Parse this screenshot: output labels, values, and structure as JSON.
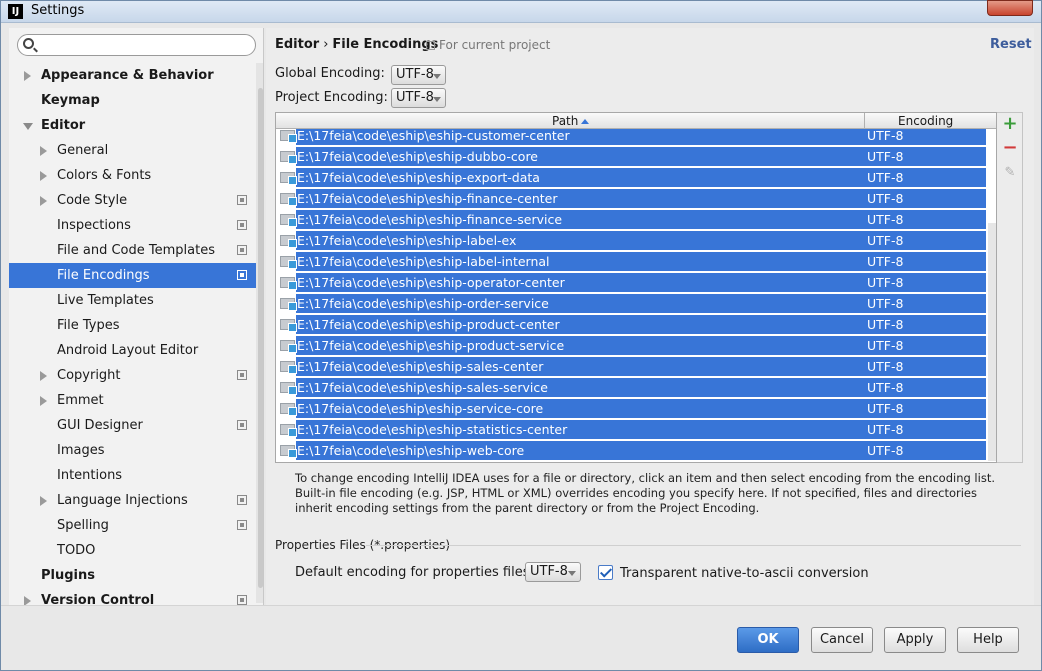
{
  "window": {
    "title": "Settings",
    "app_icon": "IJ"
  },
  "search": {
    "placeholder": "",
    "value": ""
  },
  "sidebar": {
    "items": [
      {
        "label": "Appearance & Behavior",
        "level": 0,
        "bold": true,
        "arrow": "right",
        "project": false,
        "selected": false
      },
      {
        "label": "Keymap",
        "level": 0,
        "bold": true,
        "arrow": "none",
        "project": false,
        "selected": false
      },
      {
        "label": "Editor",
        "level": 0,
        "bold": true,
        "arrow": "down",
        "project": false,
        "selected": false
      },
      {
        "label": "General",
        "level": 1,
        "bold": false,
        "arrow": "right",
        "project": false,
        "selected": false
      },
      {
        "label": "Colors & Fonts",
        "level": 1,
        "bold": false,
        "arrow": "right",
        "project": false,
        "selected": false
      },
      {
        "label": "Code Style",
        "level": 1,
        "bold": false,
        "arrow": "right",
        "project": true,
        "selected": false
      },
      {
        "label": "Inspections",
        "level": 1,
        "bold": false,
        "arrow": "none",
        "project": true,
        "selected": false
      },
      {
        "label": "File and Code Templates",
        "level": 1,
        "bold": false,
        "arrow": "none",
        "project": true,
        "selected": false
      },
      {
        "label": "File Encodings",
        "level": 1,
        "bold": false,
        "arrow": "none",
        "project": true,
        "selected": true
      },
      {
        "label": "Live Templates",
        "level": 1,
        "bold": false,
        "arrow": "none",
        "project": false,
        "selected": false
      },
      {
        "label": "File Types",
        "level": 1,
        "bold": false,
        "arrow": "none",
        "project": false,
        "selected": false
      },
      {
        "label": "Android Layout Editor",
        "level": 1,
        "bold": false,
        "arrow": "none",
        "project": false,
        "selected": false
      },
      {
        "label": "Copyright",
        "level": 1,
        "bold": false,
        "arrow": "right",
        "project": true,
        "selected": false
      },
      {
        "label": "Emmet",
        "level": 1,
        "bold": false,
        "arrow": "right",
        "project": false,
        "selected": false
      },
      {
        "label": "GUI Designer",
        "level": 1,
        "bold": false,
        "arrow": "none",
        "project": true,
        "selected": false
      },
      {
        "label": "Images",
        "level": 1,
        "bold": false,
        "arrow": "none",
        "project": false,
        "selected": false
      },
      {
        "label": "Intentions",
        "level": 1,
        "bold": false,
        "arrow": "none",
        "project": false,
        "selected": false
      },
      {
        "label": "Language Injections",
        "level": 1,
        "bold": false,
        "arrow": "right",
        "project": true,
        "selected": false
      },
      {
        "label": "Spelling",
        "level": 1,
        "bold": false,
        "arrow": "none",
        "project": true,
        "selected": false
      },
      {
        "label": "TODO",
        "level": 1,
        "bold": false,
        "arrow": "none",
        "project": false,
        "selected": false
      },
      {
        "label": "Plugins",
        "level": 0,
        "bold": true,
        "arrow": "none",
        "project": false,
        "selected": false
      },
      {
        "label": "Version Control",
        "level": 0,
        "bold": true,
        "arrow": "right",
        "project": true,
        "selected": false
      }
    ]
  },
  "header": {
    "crumb_parent": "Editor",
    "crumb_sep": "›",
    "crumb_current": "File Encodings",
    "for_project": "For current project",
    "reset": "Reset"
  },
  "encodings": {
    "global_label": "Global Encoding:",
    "global_value": "UTF-8",
    "project_label": "Project Encoding:",
    "project_value": "UTF-8"
  },
  "table": {
    "col_path": "Path",
    "col_encoding": "Encoding",
    "rows": [
      {
        "path": "E:\\17feia\\code\\eship\\eship-customer-center",
        "encoding": "UTF-8"
      },
      {
        "path": "E:\\17feia\\code\\eship\\eship-dubbo-core",
        "encoding": "UTF-8"
      },
      {
        "path": "E:\\17feia\\code\\eship\\eship-export-data",
        "encoding": "UTF-8"
      },
      {
        "path": "E:\\17feia\\code\\eship\\eship-finance-center",
        "encoding": "UTF-8"
      },
      {
        "path": "E:\\17feia\\code\\eship\\eship-finance-service",
        "encoding": "UTF-8"
      },
      {
        "path": "E:\\17feia\\code\\eship\\eship-label-ex",
        "encoding": "UTF-8"
      },
      {
        "path": "E:\\17feia\\code\\eship\\eship-label-internal",
        "encoding": "UTF-8"
      },
      {
        "path": "E:\\17feia\\code\\eship\\eship-operator-center",
        "encoding": "UTF-8"
      },
      {
        "path": "E:\\17feia\\code\\eship\\eship-order-service",
        "encoding": "UTF-8"
      },
      {
        "path": "E:\\17feia\\code\\eship\\eship-product-center",
        "encoding": "UTF-8"
      },
      {
        "path": "E:\\17feia\\code\\eship\\eship-product-service",
        "encoding": "UTF-8"
      },
      {
        "path": "E:\\17feia\\code\\eship\\eship-sales-center",
        "encoding": "UTF-8"
      },
      {
        "path": "E:\\17feia\\code\\eship\\eship-sales-service",
        "encoding": "UTF-8"
      },
      {
        "path": "E:\\17feia\\code\\eship\\eship-service-core",
        "encoding": "UTF-8"
      },
      {
        "path": "E:\\17feia\\code\\eship\\eship-statistics-center",
        "encoding": "UTF-8"
      },
      {
        "path": "E:\\17feia\\code\\eship\\eship-web-core",
        "encoding": "UTF-8"
      }
    ]
  },
  "help_text": "To change encoding IntelliJ IDEA uses for a file or directory, click an item and then select encoding from the encoding list. Built-in file encoding (e.g. JSP, HTML or XML) overrides encoding you specify here. If not specified, files and directories inherit encoding settings from the parent directory or from the Project Encoding.",
  "properties": {
    "title": "Properties Files (*.properties)",
    "default_label": "Default encoding for properties files:",
    "default_value": "UTF-8",
    "native_to_ascii_label": "Transparent native-to-ascii conversion",
    "native_to_ascii_checked": true
  },
  "footer": {
    "ok": "OK",
    "cancel": "Cancel",
    "apply": "Apply",
    "help": "Help"
  },
  "colors": {
    "selection": "#3875d7",
    "link": "#3d5d9c",
    "add": "#3b9c3b",
    "remove": "#d13a3a"
  }
}
